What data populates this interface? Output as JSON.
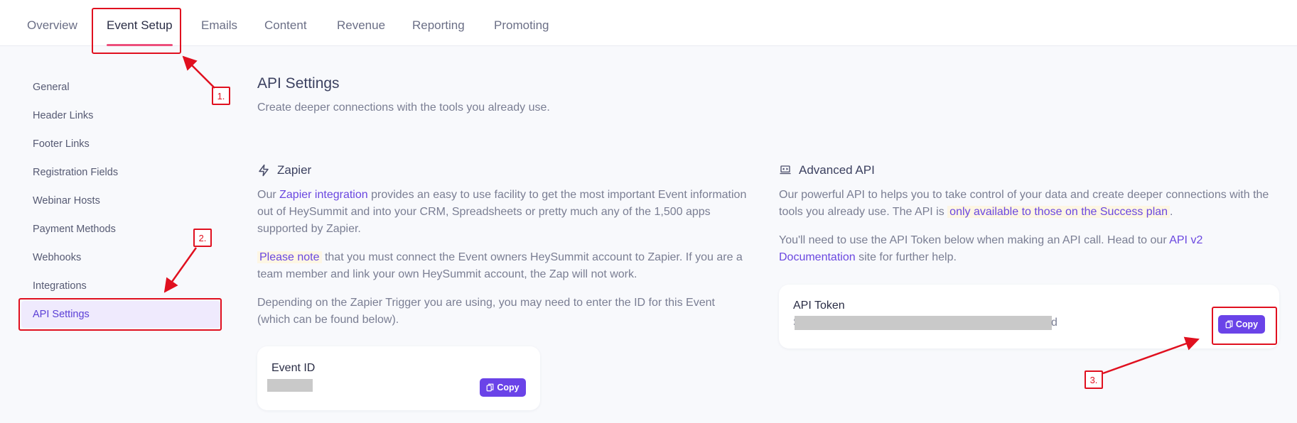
{
  "tabs": [
    {
      "label": "Overview"
    },
    {
      "label": "Event Setup"
    },
    {
      "label": "Emails"
    },
    {
      "label": "Content"
    },
    {
      "label": "Revenue"
    },
    {
      "label": "Reporting"
    },
    {
      "label": "Promoting"
    }
  ],
  "sidebar": {
    "items": [
      {
        "label": "General"
      },
      {
        "label": "Header Links"
      },
      {
        "label": "Footer Links"
      },
      {
        "label": "Registration Fields"
      },
      {
        "label": "Webinar Hosts"
      },
      {
        "label": "Payment Methods"
      },
      {
        "label": "Webhooks"
      },
      {
        "label": "Integrations"
      },
      {
        "label": "API Settings"
      }
    ]
  },
  "page": {
    "title": "API Settings",
    "subtitle": "Create deeper connections with the tools you already use."
  },
  "zapier": {
    "title": "Zapier",
    "p1_before": "Our ",
    "p1_link": "Zapier integration",
    "p1_after": " provides an easy to use facility to get the most important Event information out of HeySummit and into your CRM, Spreadsheets or pretty much any of the 1,500 apps supported by Zapier.",
    "p2_note": "Please note",
    "p2_after": " that you must connect the Event owners HeySummit account to Zapier. If you are a team member and link your own HeySummit account, the Zap will not work.",
    "p3": "Depending on the Zapier Trigger you are using, you may need to enter the ID for this Event (which can be found below).",
    "card_label": "Event ID",
    "copy_label": "Copy"
  },
  "advanced": {
    "title": "Advanced API",
    "p1_before": "Our powerful API to helps you to take control of your data and create deeper connections with the tools you already use. The API is ",
    "p1_highlight": "only available to those on the Success plan",
    "p1_after": ".",
    "p2_before": "You'll need to use the API Token below when making an API call. Head to our ",
    "p2_link": "API v2 Documentation",
    "p2_after": " site for further help.",
    "card_label": "API Token",
    "token_head": "S",
    "token_tail": "d",
    "copy_label": "Copy"
  },
  "annotations": {
    "n1": "1.",
    "n2": "2.",
    "n3": "3.",
    "color": "#e0101f"
  }
}
